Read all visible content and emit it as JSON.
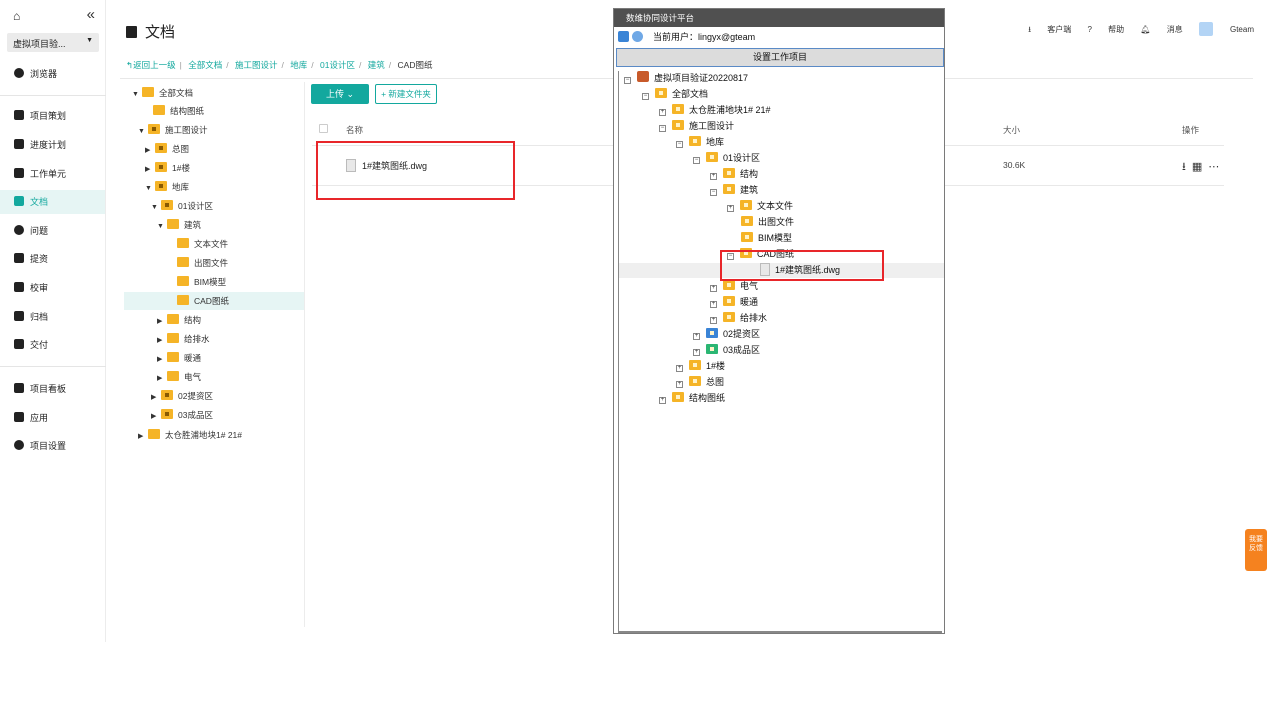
{
  "sidebar": {
    "project_select": "虚拟项目验...",
    "browser": "浏览器",
    "items": [
      {
        "label": "项目策划"
      },
      {
        "label": "进度计划"
      },
      {
        "label": "工作单元"
      },
      {
        "label": "文档"
      },
      {
        "label": "问题"
      },
      {
        "label": "提资"
      },
      {
        "label": "校审"
      },
      {
        "label": "归档"
      },
      {
        "label": "交付"
      }
    ],
    "bottom_items": [
      {
        "label": "项目看板"
      },
      {
        "label": "应用"
      },
      {
        "label": "项目设置"
      }
    ]
  },
  "header": {
    "title": "文档",
    "client_link": "客户端",
    "help": "帮助",
    "messages": "消息",
    "user": "Gteam"
  },
  "breadcrumb": {
    "back": "返回上一级",
    "items": [
      "全部文档",
      "施工图设计",
      "地库",
      "01设计区",
      "建筑"
    ],
    "current": "CAD图纸"
  },
  "tree": [
    {
      "label": "全部文档"
    },
    {
      "label": "结构图纸"
    },
    {
      "label": "施工图设计"
    },
    {
      "label": "总图"
    },
    {
      "label": "1#楼"
    },
    {
      "label": "地库"
    },
    {
      "label": "01设计区"
    },
    {
      "label": "建筑"
    },
    {
      "label": "文本文件"
    },
    {
      "label": "出图文件"
    },
    {
      "label": "BIM模型"
    },
    {
      "label": "CAD图纸"
    },
    {
      "label": "结构"
    },
    {
      "label": "给排水"
    },
    {
      "label": "暖通"
    },
    {
      "label": "电气"
    },
    {
      "label": "02提资区"
    },
    {
      "label": "03成品区"
    },
    {
      "label": "太仓胜浦地块1# 21#"
    }
  ],
  "toolbar": {
    "upload": "上传",
    "new_folder": "+ 新建文件夹"
  },
  "table": {
    "col_name": "名称",
    "col_size": "大小",
    "col_ops": "操作",
    "rows": [
      {
        "name": "1#建筑图纸.dwg",
        "size": "30.6K"
      }
    ]
  },
  "client": {
    "title": "数维协同设计平台",
    "user_label": "当前用户：lingyx@gteam",
    "set_project": "设置工作项目",
    "tree": [
      {
        "label": "虚拟项目验证20220817"
      },
      {
        "label": "全部文档"
      },
      {
        "label": "太仓胜浦地块1# 21#"
      },
      {
        "label": "施工图设计"
      },
      {
        "label": "地库"
      },
      {
        "label": "01设计区"
      },
      {
        "label": "结构"
      },
      {
        "label": "建筑"
      },
      {
        "label": "文本文件"
      },
      {
        "label": "出图文件"
      },
      {
        "label": "BIM模型"
      },
      {
        "label": "CAD图纸"
      },
      {
        "label": "1#建筑图纸.dwg"
      },
      {
        "label": "电气"
      },
      {
        "label": "暖通"
      },
      {
        "label": "给排水"
      },
      {
        "label": "02提资区"
      },
      {
        "label": "03成品区"
      },
      {
        "label": "1#楼"
      },
      {
        "label": "总图"
      },
      {
        "label": "结构图纸"
      }
    ]
  },
  "feedback": {
    "line1": "我要",
    "line2": "反馈"
  },
  "colors": {
    "accent": "#13a89e",
    "highlight_box": "#e8262a",
    "folder": "#f5b427"
  }
}
